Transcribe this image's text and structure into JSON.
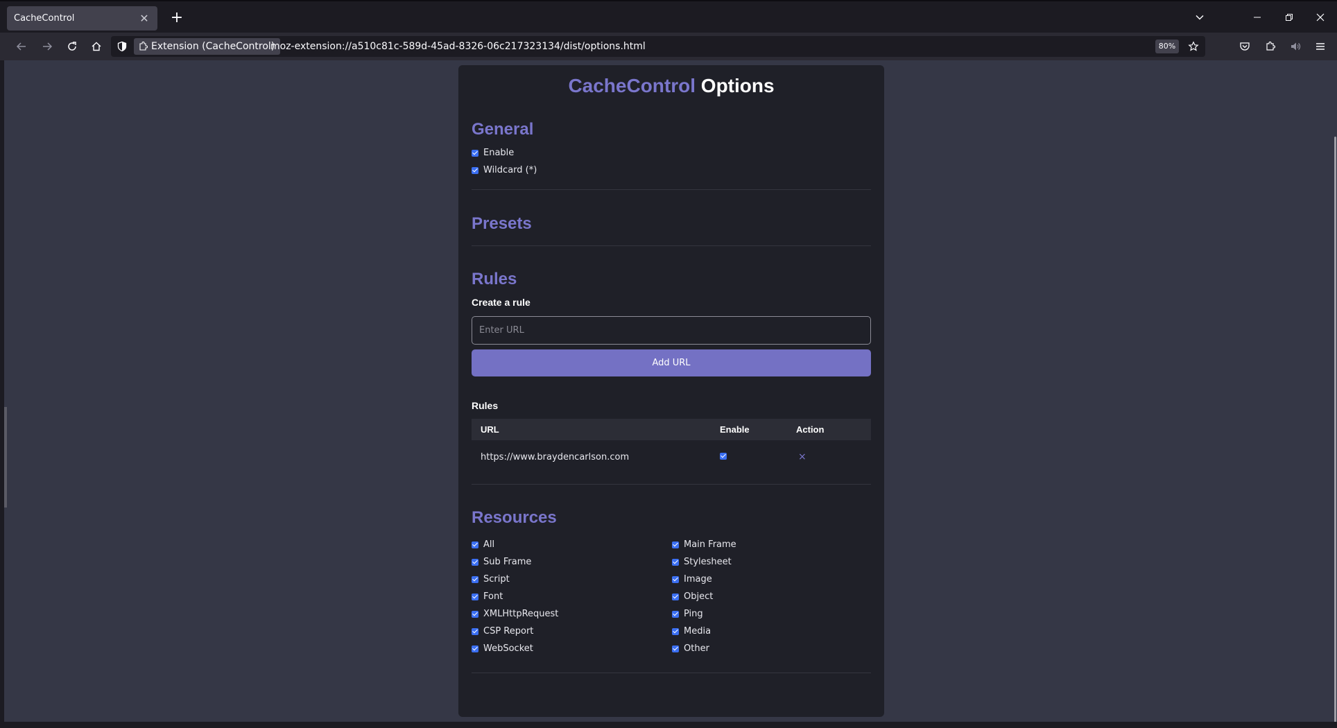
{
  "browser": {
    "tab_title": "CacheControl",
    "identity_label": "Extension (CacheControl)",
    "url": "moz-extension://a510c81c-589d-45ad-8326-06c217323134/dist/options.html",
    "zoom": "80%"
  },
  "page": {
    "title_brand": "CacheControl",
    "title_rest": "Options",
    "accent_color": "#7a76cc"
  },
  "general": {
    "heading": "General",
    "options": [
      {
        "label": "Enable",
        "checked": true
      },
      {
        "label": "Wildcard (*)",
        "checked": true
      }
    ]
  },
  "presets": {
    "heading": "Presets"
  },
  "rules": {
    "heading": "Rules",
    "create_label": "Create a rule",
    "input_placeholder": "Enter URL",
    "add_button": "Add URL",
    "list_heading": "Rules",
    "columns": [
      "URL",
      "Enable",
      "Action"
    ],
    "rows": [
      {
        "url": "https://www.braydencarlson.com",
        "enabled": true,
        "action": "×"
      }
    ]
  },
  "resources": {
    "heading": "Resources",
    "left": [
      {
        "label": "All",
        "checked": true
      },
      {
        "label": "Sub Frame",
        "checked": true
      },
      {
        "label": "Script",
        "checked": true
      },
      {
        "label": "Font",
        "checked": true
      },
      {
        "label": "XMLHttpRequest",
        "checked": true
      },
      {
        "label": "CSP Report",
        "checked": true
      },
      {
        "label": "WebSocket",
        "checked": true
      }
    ],
    "right": [
      {
        "label": "Main Frame",
        "checked": true
      },
      {
        "label": "Stylesheet",
        "checked": true
      },
      {
        "label": "Image",
        "checked": true
      },
      {
        "label": "Object",
        "checked": true
      },
      {
        "label": "Ping",
        "checked": true
      },
      {
        "label": "Media",
        "checked": true
      },
      {
        "label": "Other",
        "checked": true
      }
    ]
  }
}
